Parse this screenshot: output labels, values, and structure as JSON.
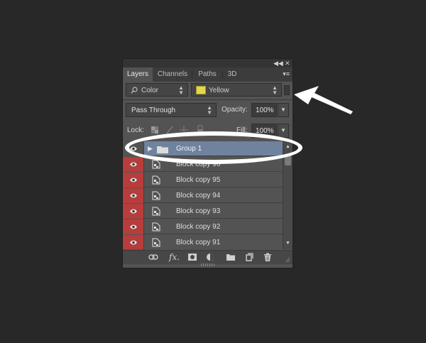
{
  "panel": {
    "tabs": [
      "Layers",
      "Channels",
      "Paths",
      "3D"
    ],
    "active_tab": "Layers"
  },
  "filter": {
    "kind_label": "Color",
    "color_label": "Yellow",
    "swatch_color": "#e3d74d"
  },
  "blend": {
    "mode": "Pass Through",
    "opacity_label": "Opacity:",
    "opacity_value": "100%"
  },
  "lock": {
    "label": "Lock:",
    "fill_label": "Fill:",
    "fill_value": "100%"
  },
  "layers": [
    {
      "name": "Group 1",
      "type": "group",
      "selected": true,
      "visible_color": "none"
    },
    {
      "name": "Block copy 96",
      "type": "layer",
      "selected": false,
      "visible_color": "red"
    },
    {
      "name": "Block copy 95",
      "type": "layer",
      "selected": false,
      "visible_color": "red"
    },
    {
      "name": "Block copy 94",
      "type": "layer",
      "selected": false,
      "visible_color": "red"
    },
    {
      "name": "Block copy 93",
      "type": "layer",
      "selected": false,
      "visible_color": "red"
    },
    {
      "name": "Block copy 92",
      "type": "layer",
      "selected": false,
      "visible_color": "red"
    },
    {
      "name": "Block copy 91",
      "type": "layer",
      "selected": false,
      "visible_color": "red"
    }
  ],
  "colors": {
    "background": "#282828",
    "panel": "#535353",
    "selected_row": "#6f839f",
    "eye_column": "#b73c3c",
    "annotation": "#ffffff"
  },
  "icons": [
    "collapse-icon",
    "close-icon",
    "panel-menu-icon",
    "search-icon",
    "eye-icon",
    "folder-icon",
    "layer-doc-icon",
    "link-icon",
    "fx-icon",
    "mask-icon",
    "adjustment-icon",
    "new-group-icon",
    "new-layer-icon",
    "trash-icon"
  ]
}
